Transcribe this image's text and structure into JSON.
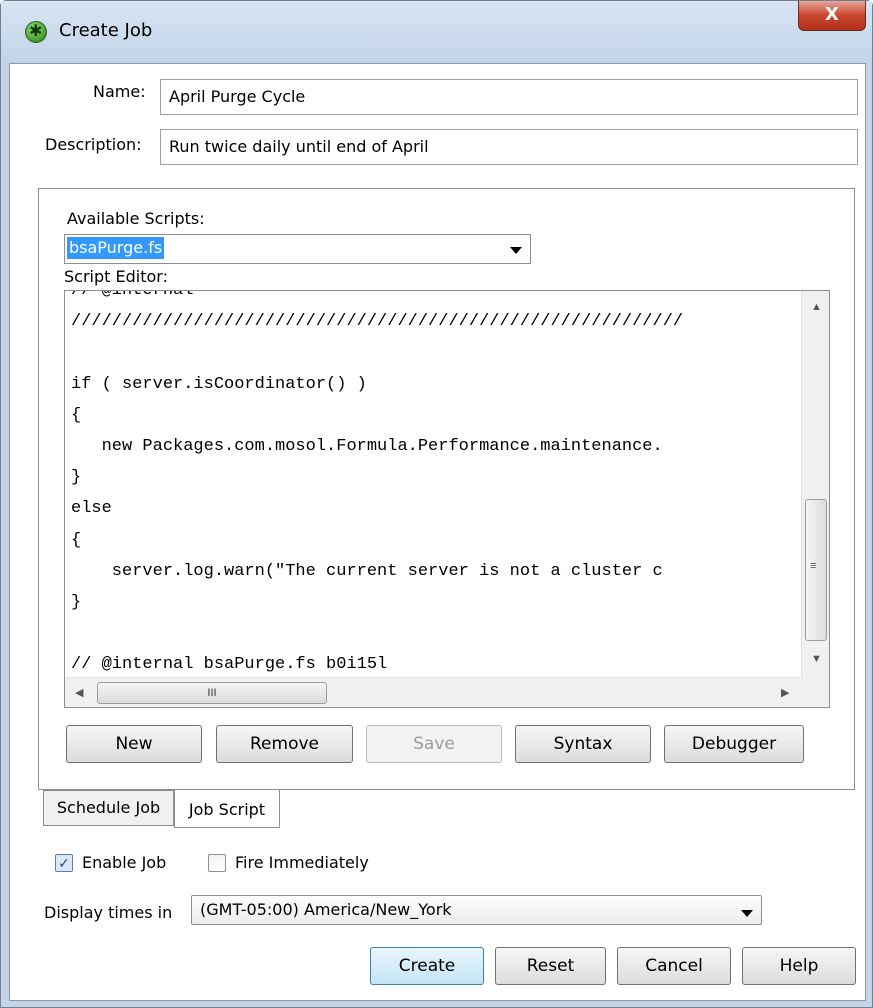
{
  "window": {
    "title": "Create Job",
    "close_glyph": "X"
  },
  "form": {
    "name_label": "Name:",
    "name_value": "April Purge Cycle",
    "description_label": "Description:",
    "description_value": "Run twice daily until end of April"
  },
  "scripts": {
    "available_label": "Available Scripts:",
    "selected_script": "bsaPurge.fs",
    "editor_label": "Script Editor:",
    "code_lines": [
      "// @internal",
      "////////////////////////////////////////////////////////////",
      "",
      "if ( server.isCoordinator() )",
      "{",
      "   new Packages.com.mosol.Formula.Performance.maintenance.",
      "}",
      "else",
      "{",
      "    server.log.warn(\"The current server is not a cluster c",
      "}",
      "",
      "// @internal bsaPurge.fs b0i15l"
    ],
    "hscroll_thumb_grip": "III",
    "buttons": {
      "new": "New",
      "remove": "Remove",
      "save": "Save",
      "syntax": "Syntax",
      "debugger": "Debugger"
    }
  },
  "tabs": [
    {
      "label": "Schedule Job",
      "active": false
    },
    {
      "label": "Job Script",
      "active": true
    }
  ],
  "options": {
    "enable_job_label": "Enable Job",
    "enable_job_checked": true,
    "fire_immediately_label": "Fire Immediately",
    "fire_immediately_checked": false,
    "display_times_label": "Display times in",
    "timezone_value": "(GMT-05:00) America/New_York"
  },
  "footer": {
    "create": "Create",
    "reset": "Reset",
    "cancel": "Cancel",
    "help": "Help"
  },
  "colors": {
    "selection": "#3399ff",
    "window_frame": "#c4d3e6"
  }
}
